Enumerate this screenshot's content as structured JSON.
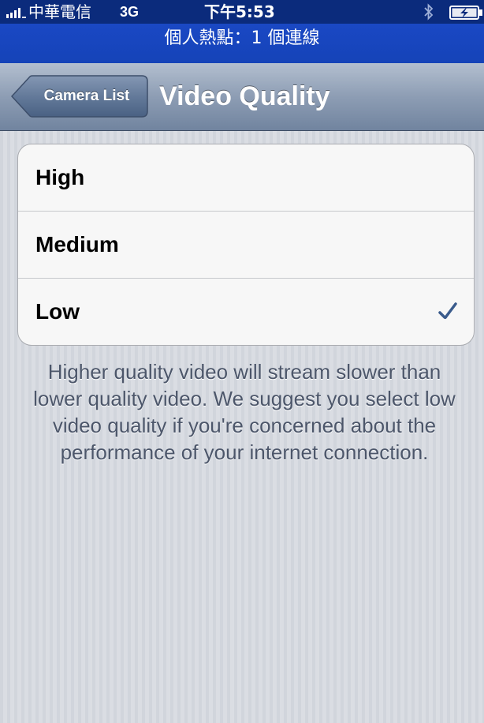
{
  "status_bar": {
    "carrier": "中華電信",
    "network": "3G",
    "time": "下午5:53",
    "signal_bars": 4,
    "bluetooth_icon": "bluetooth-icon",
    "battery_icon": "battery-charging-icon"
  },
  "hotspot": {
    "text": "個人熱點：1 個連線"
  },
  "nav": {
    "back_label": "Camera List",
    "title": "Video Quality"
  },
  "options": [
    {
      "label": "High",
      "selected": false
    },
    {
      "label": "Medium",
      "selected": false
    },
    {
      "label": "Low",
      "selected": true
    }
  ],
  "check_icon": "checkmark-icon",
  "footer_note": "Higher quality video will stream slower than lower quality video. We suggest you select low video quality if you're concerned about the performance of your internet connection.",
  "colors": {
    "status_bar": "#0b2b7c",
    "hotspot_bar": "#1a48c4",
    "nav_bar": "#8d9db4",
    "checkmark": "#3a5b8c",
    "footer_text": "#4c566a"
  }
}
